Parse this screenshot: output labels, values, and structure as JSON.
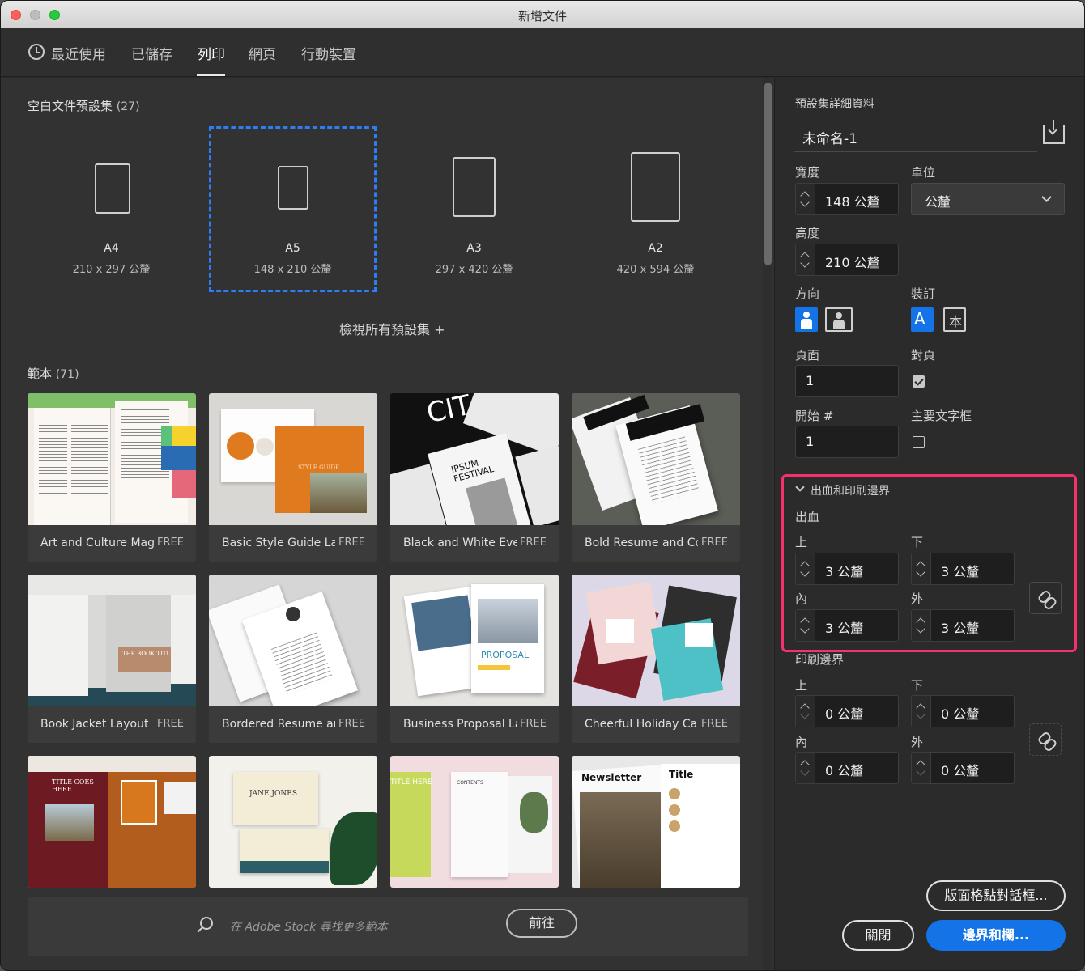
{
  "window": {
    "title": "新增文件"
  },
  "tabs": [
    "最近使用",
    "已儲存",
    "列印",
    "網頁",
    "行動裝置"
  ],
  "active_tab": "列印",
  "presets_section": {
    "title": "空白文件預設集",
    "count": "(27)"
  },
  "presets": [
    {
      "name": "A4",
      "size": "210 x 297 公釐"
    },
    {
      "name": "A5",
      "size": "148 x 210 公釐",
      "selected": true
    },
    {
      "name": "A3",
      "size": "297 x 420 公釐"
    },
    {
      "name": "A2",
      "size": "420 x 594 公釐"
    }
  ],
  "view_all": "檢視所有預設集 +",
  "templates_section": {
    "title": "範本",
    "count": "(71)"
  },
  "templates": [
    {
      "name": "Art and Culture Mag...",
      "badge": "FREE"
    },
    {
      "name": "Basic Style Guide La...",
      "badge": "FREE"
    },
    {
      "name": "Black and White Eve...",
      "badge": "FREE"
    },
    {
      "name": "Bold Resume and Co...",
      "badge": "FREE"
    },
    {
      "name": "Book Jacket Layout",
      "badge": "FREE"
    },
    {
      "name": "Bordered Resume an...",
      "badge": "FREE"
    },
    {
      "name": "Business Proposal La...",
      "badge": "FREE"
    },
    {
      "name": "Cheerful Holiday Car...",
      "badge": "FREE"
    }
  ],
  "thumb_text": {
    "cit": "CIT",
    "ipsum": "IPSUM FESTIVAL",
    "style_guide": "STYLE GUIDE",
    "book_title": "THE BOOK TITLE",
    "proposal": "PROPOSAL",
    "title_goes_here": "TITLE GOES HERE",
    "jane_jones": "JANE JONES",
    "title_here": "TITLE HERE",
    "contents": "CONTENTS",
    "newsletter": "Newsletter",
    "title": "Title"
  },
  "stock": {
    "placeholder": "在 Adobe Stock 尋找更多範本",
    "go_label": "前往"
  },
  "details": {
    "header": "預設集詳細資料",
    "preset_name": "未命名-1",
    "width_label": "寬度",
    "width_value": "148 公釐",
    "units_label": "單位",
    "units_value": "公釐",
    "height_label": "高度",
    "height_value": "210 公釐",
    "orientation_label": "方向",
    "binding_label": "裝訂",
    "pages_label": "頁面",
    "pages_value": "1",
    "facing_label": "對頁",
    "facing_checked": true,
    "start_label": "開始 #",
    "start_value": "1",
    "primary_frame_label": "主要文字框",
    "primary_frame_checked": false,
    "bleed_slug_section": "出血和印刷邊界",
    "bleed_label": "出血",
    "bleed": {
      "top_label": "上",
      "top": "3 公釐",
      "bottom_label": "下",
      "bottom": "3 公釐",
      "inside_label": "內",
      "inside": "3 公釐",
      "outside_label": "外",
      "outside": "3 公釐"
    },
    "slug_label": "印刷邊界",
    "slug": {
      "top_label": "上",
      "top": "0 公釐",
      "bottom_label": "下",
      "bottom": "0 公釐",
      "inside_label": "內",
      "inside": "0 公釐",
      "outside_label": "外",
      "outside": "0 公釐"
    }
  },
  "buttons": {
    "layout_grid": "版面格點對話框...",
    "close": "關閉",
    "margins_columns": "邊界和欄..."
  },
  "colors": {
    "accent": "#1473e6",
    "selection": "#2e7cf6",
    "highlight": "#f5306c"
  }
}
